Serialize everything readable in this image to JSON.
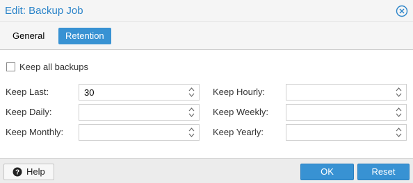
{
  "window": {
    "title": "Edit: Backup Job",
    "close_icon": "close-circle-icon"
  },
  "tabs": [
    {
      "label": "General",
      "active": false
    },
    {
      "label": "Retention",
      "active": true
    }
  ],
  "form": {
    "keep_all": {
      "label": "Keep all backups",
      "checked": false
    },
    "fields": {
      "keep_last": {
        "label": "Keep Last:",
        "value": "30"
      },
      "keep_hourly": {
        "label": "Keep Hourly:",
        "value": ""
      },
      "keep_daily": {
        "label": "Keep Daily:",
        "value": ""
      },
      "keep_weekly": {
        "label": "Keep Weekly:",
        "value": ""
      },
      "keep_monthly": {
        "label": "Keep Monthly:",
        "value": ""
      },
      "keep_yearly": {
        "label": "Keep Yearly:",
        "value": ""
      }
    }
  },
  "footer": {
    "help_label": "Help",
    "help_icon": "help-circle-icon",
    "ok_label": "OK",
    "reset_label": "Reset"
  },
  "colors": {
    "accent": "#3892d3",
    "title_text": "#2b84c9"
  }
}
